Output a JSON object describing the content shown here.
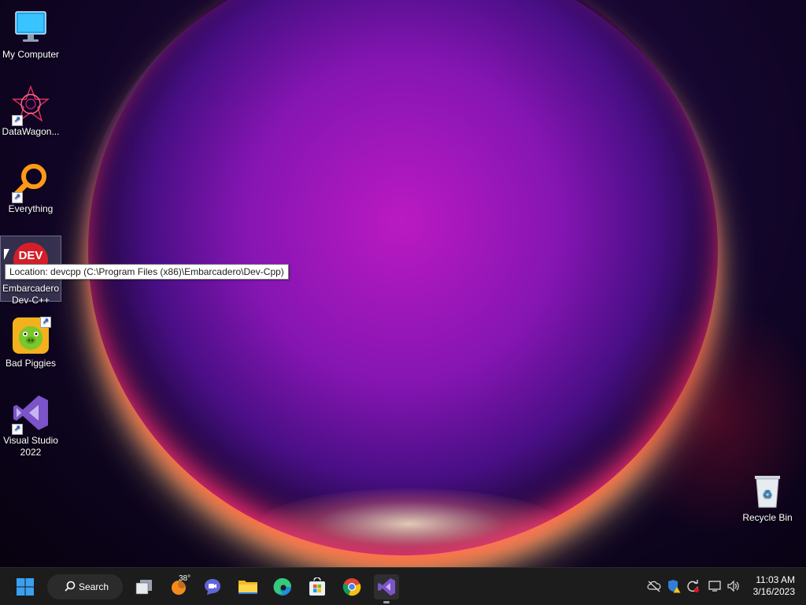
{
  "desktop": {
    "icons": [
      {
        "label": "My Computer",
        "icon": "monitor-icon"
      },
      {
        "label": "DataWagon...",
        "icon": "datawagon-icon"
      },
      {
        "label": "Everything",
        "icon": "everything-search-icon"
      },
      {
        "label": "Embarcadero Dev-C++",
        "label_line1": "Embarcadero",
        "label_line2": "Dev-C++",
        "icon": "devcpp-icon",
        "badge_text": "DEV"
      },
      {
        "label": "Bad Piggies",
        "icon": "bad-piggies-icon"
      },
      {
        "label": "Visual Studio 2022",
        "label_line1": "Visual Studio",
        "label_line2": "2022",
        "icon": "visual-studio-icon"
      },
      {
        "label": "Recycle Bin",
        "icon": "recycle-bin-icon"
      }
    ],
    "tooltip": "Location: devcpp (C:\\Program Files (x86)\\Embarcadero\\Dev-Cpp)"
  },
  "taskbar": {
    "search_label": "Search",
    "weather_temp": "38°",
    "apps": [
      "start",
      "task-view",
      "weather",
      "teams-chat",
      "file-explorer",
      "edge",
      "store",
      "chrome",
      "visual-studio"
    ],
    "clock_time": "11:03 AM",
    "clock_date": "3/16/2023"
  },
  "colors": {
    "taskbar_bg": "#1c1c1c",
    "accent_windows": "#3aa0f0",
    "vs_purple": "#7b54c9"
  }
}
